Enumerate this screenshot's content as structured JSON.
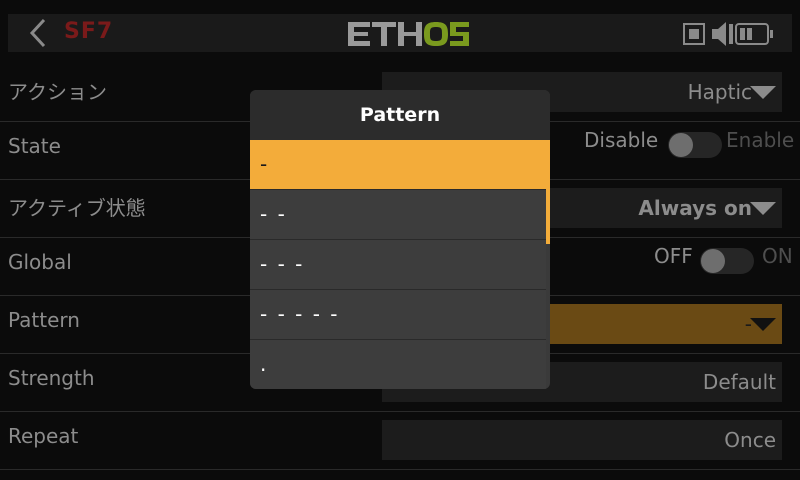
{
  "header": {
    "title": "SF7",
    "logo": "ETHOS"
  },
  "rows": {
    "action": {
      "label": "アクション",
      "value": "Haptic"
    },
    "state": {
      "label": "State",
      "off_label": "Disable",
      "on_label": "Enable",
      "enabled": false
    },
    "active_state": {
      "label": "アクティブ状態",
      "value": "Always on"
    },
    "global": {
      "label": "Global",
      "off_label": "OFF",
      "on_label": "ON",
      "enabled": false
    },
    "pattern": {
      "label": "Pattern",
      "value": "-"
    },
    "strength": {
      "label": "Strength",
      "value": "Default"
    },
    "repeat": {
      "label": "Repeat",
      "value": "Once"
    }
  },
  "modal": {
    "title": "Pattern",
    "options": [
      "-",
      "- -",
      "- - -",
      "- - - - -",
      "."
    ],
    "selected_index": 0
  },
  "colors": {
    "accent": "#f3ac3a",
    "logo_gray": "#9a9a9a",
    "logo_green": "#7a9a1e",
    "title_red": "#7a1a1a"
  },
  "icons": {
    "back": "chevron-left-icon",
    "model": "square-icon",
    "volume": "speaker-icon",
    "battery": "battery-icon"
  }
}
